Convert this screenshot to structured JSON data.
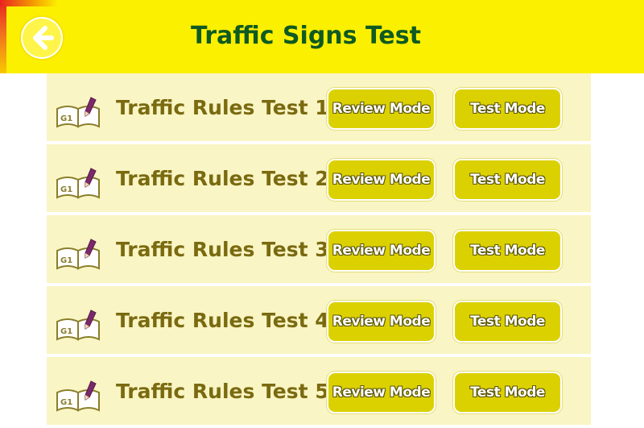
{
  "header": {
    "title": "Traffic Signs Test",
    "back_icon": "back-arrow-icon"
  },
  "colors": {
    "header_bg": "#fbf000",
    "title": "#0f5a22",
    "row_bg": "#f9f5c4",
    "row_label": "#7a6a10",
    "button_bg": "#dcd100"
  },
  "tests": [
    {
      "label": "Traffic Rules Test 1",
      "icon_text": "G1",
      "review_label": "Review Mode",
      "test_label": "Test  Mode"
    },
    {
      "label": "Traffic Rules Test 2",
      "icon_text": "G1",
      "review_label": "Review Mode",
      "test_label": "Test  Mode"
    },
    {
      "label": "Traffic Rules Test 3",
      "icon_text": "G1",
      "review_label": "Review Mode",
      "test_label": "Test  Mode"
    },
    {
      "label": "Traffic Rules Test 4",
      "icon_text": "G1",
      "review_label": "Review Mode",
      "test_label": "Test  Mode"
    },
    {
      "label": "Traffic Rules Test 5",
      "icon_text": "G1",
      "review_label": "Review Mode",
      "test_label": "Test  Mode"
    }
  ]
}
